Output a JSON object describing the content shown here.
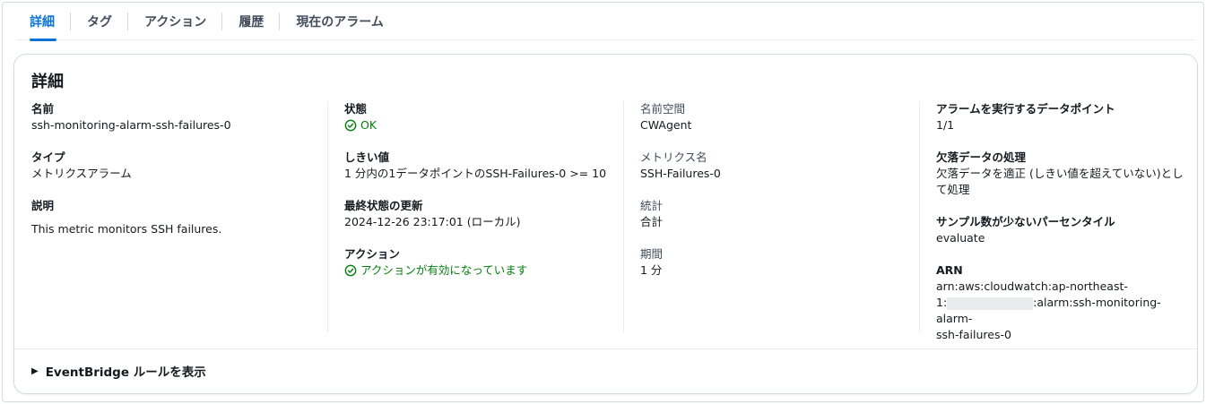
{
  "tabs": [
    {
      "label": "詳細",
      "active": true
    },
    {
      "label": "タグ",
      "active": false
    },
    {
      "label": "アクション",
      "active": false
    },
    {
      "label": "履歴",
      "active": false
    },
    {
      "label": "現在のアラーム",
      "active": false
    }
  ],
  "card": {
    "title": "詳細",
    "col1": {
      "name_label": "名前",
      "name_value": "ssh-monitoring-alarm-ssh-failures-0",
      "type_label": "タイプ",
      "type_value": "メトリクスアラーム",
      "desc_label": "説明",
      "desc_value": "This metric monitors SSH failures."
    },
    "col2": {
      "state_label": "状態",
      "state_value": "OK",
      "threshold_label": "しきい値",
      "threshold_value": "1 分内の1データポイントのSSH-Failures-0 >= 10",
      "last_update_label": "最終状態の更新",
      "last_update_value": "2024-12-26 23:17:01 (ローカル)",
      "actions_label": "アクション",
      "actions_value": "アクションが有効になっています"
    },
    "col3": {
      "namespace_label": "名前空間",
      "namespace_value": "CWAgent",
      "metric_label": "メトリクス名",
      "metric_value": "SSH-Failures-0",
      "stat_label": "統計",
      "stat_value": "合計",
      "period_label": "期間",
      "period_value": "1 分"
    },
    "col4": {
      "datapoints_label": "アラームを実行するデータポイント",
      "datapoints_value": "1/1",
      "missing_label": "欠落データの処理",
      "missing_value": "欠落データを適正 (しきい値を超えていない)として処理",
      "percentile_label": "サンプル数が少ないパーセンタイル",
      "percentile_value": "evaluate",
      "arn_label": "ARN",
      "arn_line1": "arn:aws:cloudwatch:ap-northeast-",
      "arn_line2_prefix": "1:",
      "arn_line2_suffix": ":alarm:ssh-monitoring-alarm-",
      "arn_line3": "ssh-failures-0"
    },
    "expander_label": "EventBridge ルールを表示"
  },
  "colors": {
    "accent": "#0972d3",
    "success": "#037f0c",
    "border": "#d5dbdb"
  }
}
